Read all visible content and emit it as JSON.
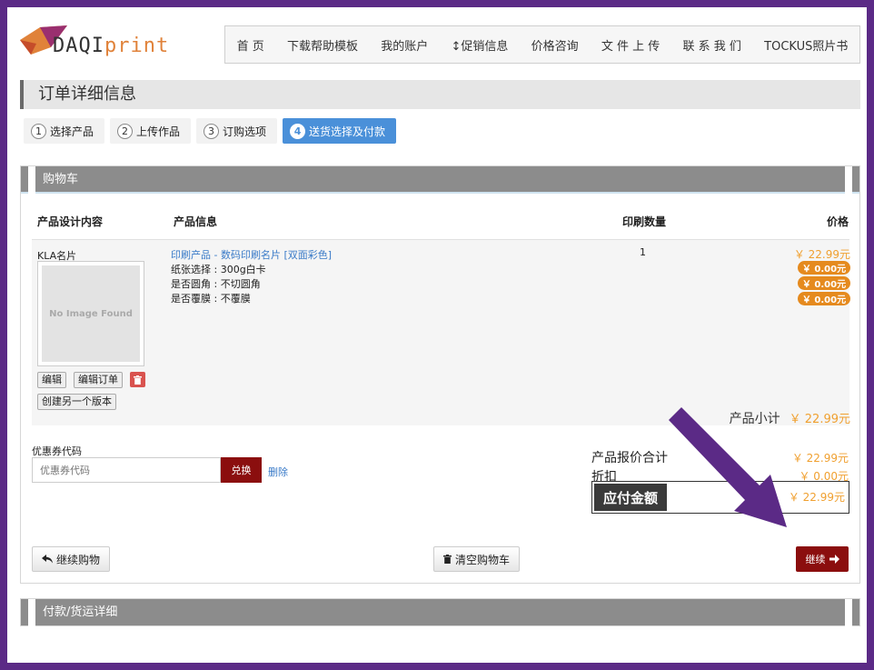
{
  "logo": {
    "text_main": "DAQI",
    "text_tail": "print"
  },
  "nav": [
    "首 页",
    "下载帮助模板",
    "我的账户",
    "↕促销信息",
    "价格咨询",
    "文 件 上 传",
    "联 系 我 们",
    "TOCKUS照片书"
  ],
  "page_title": "订单详细信息",
  "steps": [
    {
      "num": "1",
      "label": "选择产品"
    },
    {
      "num": "2",
      "label": "上传作品"
    },
    {
      "num": "3",
      "label": "订购选项"
    },
    {
      "num": "4",
      "label": "送货选择及付款"
    }
  ],
  "cart": {
    "title": "购物车",
    "headers": {
      "design": "产品设计内容",
      "info": "产品信息",
      "qty": "印刷数量",
      "price": "价格"
    },
    "item": {
      "name": "KLA名片",
      "no_image": "No Image Found",
      "edit": "编辑",
      "edit_order": "编辑订单",
      "new_version": "创建另一个版本",
      "product_link": "印刷产品 - 数码印刷名片 [双面彩色]",
      "options": [
        "纸张选择 : 300g白卡",
        "是否圆角 : 不切圆角",
        "是否覆膜 : 不覆膜"
      ],
      "qty": "1",
      "price": "￥ 22.99元",
      "option_prices": [
        "￥ 0.00元",
        "￥ 0.00元",
        "￥ 0.00元"
      ]
    },
    "subtotal_label": "产品小计",
    "subtotal_value": "￥ 22.99元",
    "coupon": {
      "label": "优惠券代码",
      "placeholder": "优惠券代码",
      "apply": "兑换",
      "remove": "删除"
    },
    "totals": {
      "quote_label": "产品报价合计",
      "quote_value": "￥ 22.99元",
      "discount_label": "折扣",
      "discount_value": "￥ 0.00元",
      "due_label": "应付金额",
      "due_value": "￥ 22.99元"
    },
    "continue_shopping": "继续购物",
    "empty_cart": "清空购物车",
    "continue": "继续"
  },
  "payment": {
    "title": "付款/货运详细"
  },
  "colors": {
    "frame": "#5b2a86",
    "accent_blue": "#4a90d9",
    "dark_red": "#8b0e0e",
    "price_orange": "#f0a030",
    "arrow": "#5b2a86"
  }
}
